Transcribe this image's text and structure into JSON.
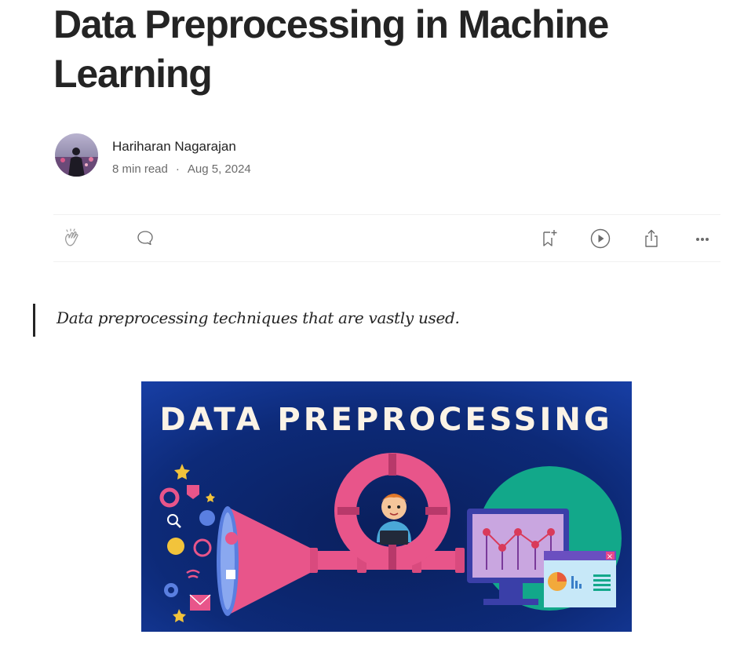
{
  "article": {
    "title": "Data Preprocessing in Machine Learning",
    "author": "Hariharan Nagarajan",
    "read_time": "8 min read",
    "separator": "·",
    "date": "Aug 5, 2024",
    "subtitle": "Data preprocessing techniques that are vastly used."
  },
  "actions": {
    "clap_icon": "clap-icon",
    "comment_icon": "comment-icon",
    "bookmark_icon": "bookmark-add-icon",
    "listen_icon": "play-icon",
    "share_icon": "share-icon",
    "more_icon": "more-icon"
  },
  "hero": {
    "heading": "DATA PREPROCESSING"
  },
  "colors": {
    "text": "#242424",
    "muted": "#6b6b6b",
    "hero_bg": "#0d2a78",
    "pink": "#e8558a",
    "teal": "#12a88a"
  }
}
